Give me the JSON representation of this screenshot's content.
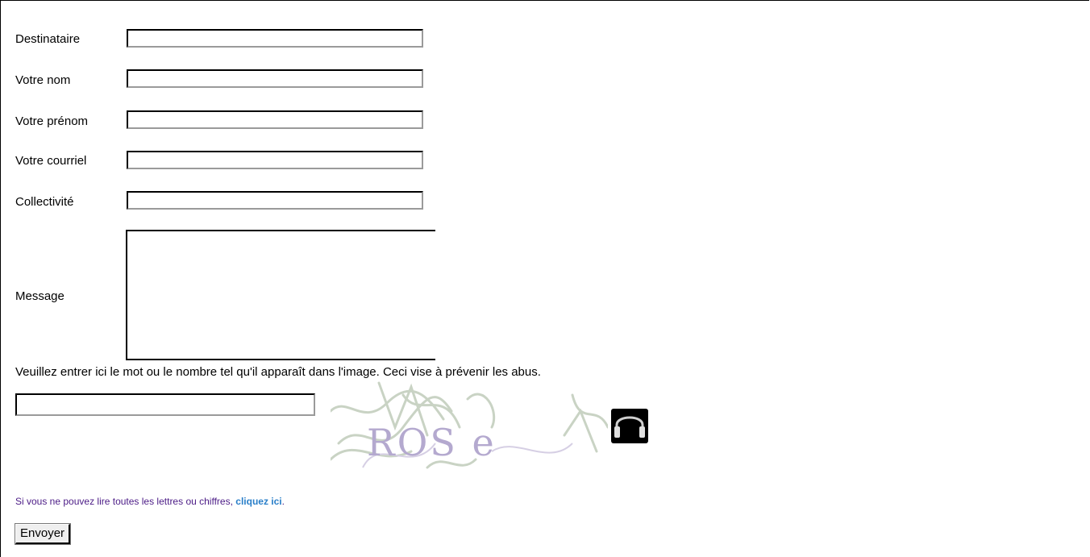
{
  "form": {
    "fields": [
      {
        "label": "Destinataire",
        "value": ""
      },
      {
        "label": "Votre nom",
        "value": ""
      },
      {
        "label": "Votre prénom",
        "value": ""
      },
      {
        "label": "Votre courriel",
        "value": ""
      },
      {
        "label": "Collectivité",
        "value": ""
      }
    ],
    "message_label": "Message",
    "message_value": ""
  },
  "captcha": {
    "instructions": "Veuillez entrer ici le mot ou le nombre tel qu'il apparaît dans l'image. Ceci vise à prévenir les abus.",
    "value": "",
    "image_text": "ROS e",
    "audio_icon": "headphones-icon",
    "help_prefix": "Si vous ne pouvez lire toutes les lettres ou chiffres, ",
    "help_link": "cliquez ici",
    "help_suffix": "."
  },
  "submit_label": "Envoyer",
  "colors": {
    "help_text": "#4b1b86",
    "link": "#2a7fc9"
  }
}
